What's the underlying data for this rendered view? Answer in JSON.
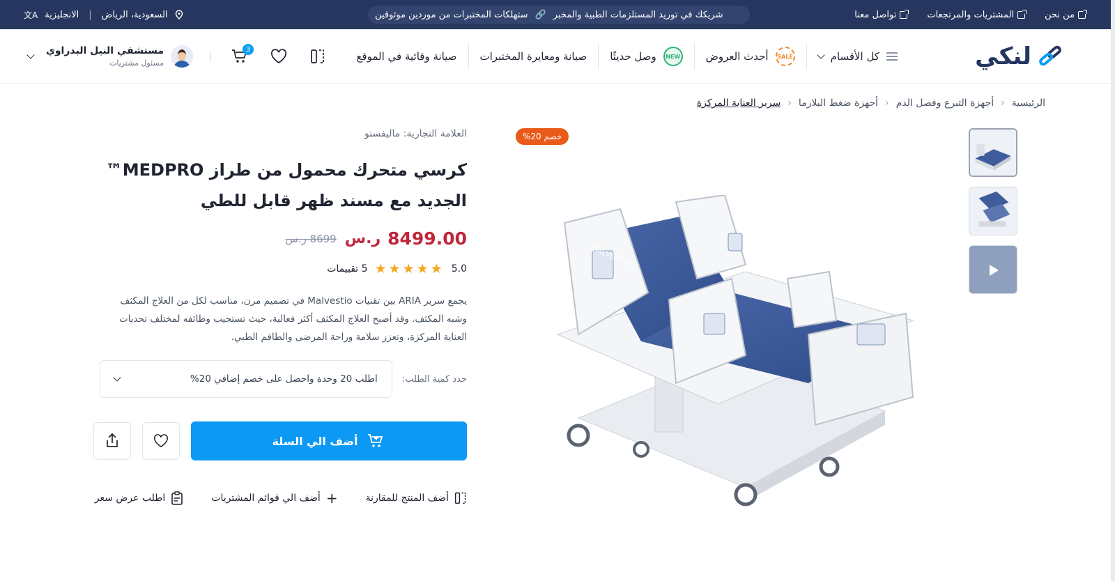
{
  "topbar": {
    "language": "الانجليزية",
    "location": "السعودية، الرياض",
    "ticker_text": "ستهلكات المختبرات من موردين موثوقين",
    "ticker_text_2": "شريكك في توريد المستلزمات الطبية والمخبر",
    "links": {
      "about": "من نحن",
      "purchases": "المشتريات والمرتجعات",
      "contact": "تواصل معنا"
    }
  },
  "header": {
    "logo_text": "لنكي",
    "nav": {
      "all_categories": "كل الأقسام",
      "offers": "أحدث العروض",
      "offers_badge": "SALE",
      "new_arrivals": "وصل حديثًا",
      "new_badge": "NEW",
      "lab_maintenance": "صيانة ومعايرة المختبرات",
      "site_maintenance": "صيانة وقائية في الموقع"
    },
    "cart_count": "3",
    "user": {
      "name": "مستشفي النيل البدراوي",
      "role": "مسئول مشتريات"
    }
  },
  "breadcrumb": {
    "home": "الرئيسية",
    "level1": "أجهزة التبرع وفصل الدم",
    "level2": "أجهزة ضغط البلازما",
    "current": "سرير العناية المركزة"
  },
  "product": {
    "discount_badge": "خصم 20%",
    "brand": "العلامة التجارية: ماليفستو",
    "title_line1": "كرسي متحرك محمول من طراز MEDPRO™",
    "title_line2": "الجديد مع مسند ظهر قابل للطي",
    "price": "8499.00",
    "currency_symbol": "ر.س",
    "old_price": "8699 ر.س",
    "rating": "5.0",
    "stars": "★★★★★",
    "reviews": "5 تقييمات",
    "description": "يجمع سرير ARIA بين تقنيات Malvestio في تصميم مرن، مناسب لكل من العلاج المكثف وشبه المكثف. وقد أصبح العلاج المكثف أكثر فعالية، حيث تستجيب وظائفه لمختلف تحديات العناية المركزة، وتعزز سلامة وراحة المرضى والطاقم الطبي.",
    "qty_label": "حدد كمية الطلب:",
    "qty_selected": "اطلب 20 وحدة واحصل على خصم إضافي 20%",
    "add_to_cart": "أضف الي السلة",
    "compare": "أضف المنتج للمقارنة",
    "add_to_list": "أضف الي قوائم المشتريات",
    "request_quote": "اطلب عرض سعر",
    "image_brand": "MALVESTIO"
  },
  "colors": {
    "topbar": "#26365e",
    "primary_button": "#0b99f4",
    "price": "#c0263a",
    "discount": "#e95a1a",
    "stars": "#f5a623"
  }
}
